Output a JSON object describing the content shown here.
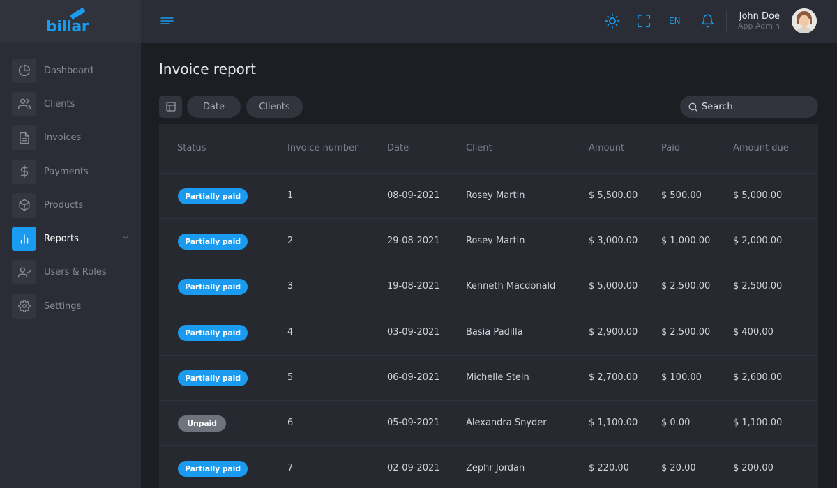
{
  "app": {
    "logo_text": "billar"
  },
  "sidebar": {
    "items": [
      {
        "label": "Dashboard",
        "icon": "pie-chart-icon",
        "active": false
      },
      {
        "label": "Clients",
        "icon": "users-icon",
        "active": false
      },
      {
        "label": "Invoices",
        "icon": "file-icon",
        "active": false
      },
      {
        "label": "Payments",
        "icon": "dollar-icon",
        "active": false
      },
      {
        "label": "Products",
        "icon": "box-icon",
        "active": false
      },
      {
        "label": "Reports",
        "icon": "bar-chart-icon",
        "active": true
      },
      {
        "label": "Users & Roles",
        "icon": "user-check-icon",
        "active": false
      },
      {
        "label": "Settings",
        "icon": "gear-icon",
        "active": false
      }
    ]
  },
  "header": {
    "language": "EN",
    "user_name": "John Doe",
    "user_role": "App Admin"
  },
  "page": {
    "title": "Invoice report",
    "filters": {
      "date_label": "Date",
      "clients_label": "Clients"
    },
    "search": {
      "placeholder": "Search"
    }
  },
  "table": {
    "columns": [
      "Status",
      "Invoice number",
      "Date",
      "Client",
      "Amount",
      "Paid",
      "Amount due"
    ],
    "rows": [
      {
        "status": "Partially paid",
        "status_type": "partial",
        "number": "1",
        "date": "08-09-2021",
        "client": "Rosey Martin",
        "amount": "$ 5,500.00",
        "paid": "$ 500.00",
        "due": "$ 5,000.00"
      },
      {
        "status": "Partially paid",
        "status_type": "partial",
        "number": "2",
        "date": "29-08-2021",
        "client": "Rosey Martin",
        "amount": "$ 3,000.00",
        "paid": "$ 1,000.00",
        "due": "$ 2,000.00"
      },
      {
        "status": "Partially paid",
        "status_type": "partial",
        "number": "3",
        "date": "19-08-2021",
        "client": "Kenneth Macdonald",
        "amount": "$ 5,000.00",
        "paid": "$ 2,500.00",
        "due": "$ 2,500.00"
      },
      {
        "status": "Partially paid",
        "status_type": "partial",
        "number": "4",
        "date": "03-09-2021",
        "client": "Basia Padilla",
        "amount": "$ 2,900.00",
        "paid": "$ 2,500.00",
        "due": "$ 400.00"
      },
      {
        "status": "Partially paid",
        "status_type": "partial",
        "number": "5",
        "date": "06-09-2021",
        "client": "Michelle Stein",
        "amount": "$ 2,700.00",
        "paid": "$ 100.00",
        "due": "$ 2,600.00"
      },
      {
        "status": "Unpaid",
        "status_type": "unpaid",
        "number": "6",
        "date": "05-09-2021",
        "client": "Alexandra Snyder",
        "amount": "$ 1,100.00",
        "paid": "$ 0.00",
        "due": "$ 1,100.00"
      },
      {
        "status": "Partially paid",
        "status_type": "partial",
        "number": "7",
        "date": "02-09-2021",
        "client": "Zephr Jordan",
        "amount": "$ 220.00",
        "paid": "$ 20.00",
        "due": "$ 200.00"
      }
    ]
  },
  "colors": {
    "accent": "#1a9bf0",
    "unpaid": "#6f737c",
    "sidebar_bg": "#2a2d35",
    "page_bg": "#1c1e24"
  }
}
